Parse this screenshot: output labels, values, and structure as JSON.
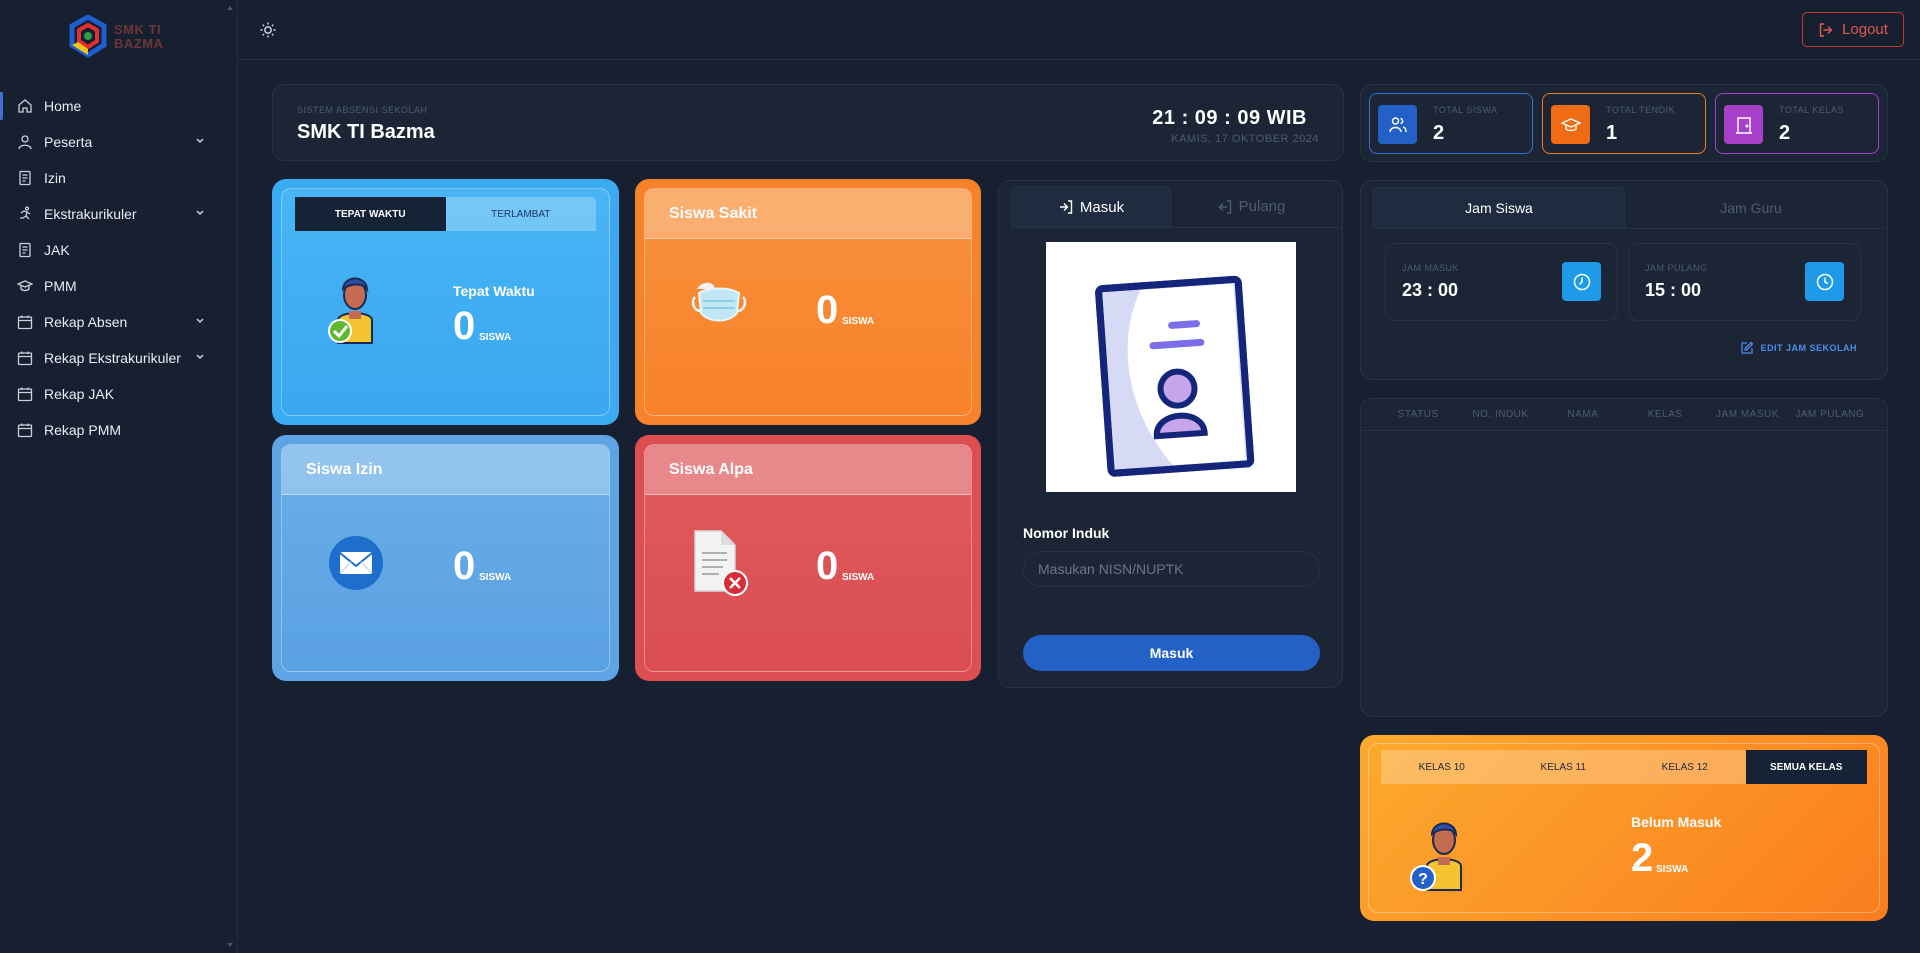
{
  "brand": {
    "line1": "SMK TI",
    "line2": "BAZMA"
  },
  "sidebar": {
    "items": [
      {
        "label": "Home",
        "icon": "home-icon"
      },
      {
        "label": "Peserta",
        "icon": "user-icon"
      },
      {
        "label": "Izin",
        "icon": "document-icon"
      },
      {
        "label": "Ekstrakurikuler",
        "icon": "running-icon"
      },
      {
        "label": "JAK",
        "icon": "document-icon"
      },
      {
        "label": "PMM",
        "icon": "graduation-cap-icon"
      },
      {
        "label": "Rekap Absen",
        "icon": "calendar-icon"
      },
      {
        "label": "Rekap Ekstrakurikuler",
        "icon": "calendar-icon"
      },
      {
        "label": "Rekap JAK",
        "icon": "calendar-icon"
      },
      {
        "label": "Rekap PMM",
        "icon": "calendar-icon"
      }
    ]
  },
  "topbar": {
    "logout_label": "Logout"
  },
  "header": {
    "subtitle": "SISTEM ABSENSI SEKOLAH",
    "school": "SMK TI Bazma",
    "clock": "21 : 09 : 09 WIB",
    "date": "KAMIS, 17 OKTOBER 2024"
  },
  "cards": {
    "tepat": {
      "tab_active": "TEPAT WAKTU",
      "tab_other": "TERLAMBAT",
      "title": "Tepat Waktu",
      "count": "0",
      "unit": "SISWA"
    },
    "sakit": {
      "title": "Siswa Sakit",
      "count": "0",
      "unit": "SISWA"
    },
    "izin": {
      "title": "Siswa Izin",
      "count": "0",
      "unit": "SISWA"
    },
    "alpa": {
      "title": "Siswa Alpa",
      "count": "0",
      "unit": "SISWA"
    }
  },
  "form": {
    "tab_masuk": "Masuk",
    "tab_pulang": "Pulang",
    "label": "Nomor Induk",
    "placeholder": "Masukan NISN/NUPTK",
    "submit": "Masuk"
  },
  "totals": {
    "siswa": {
      "label": "TOTAL SISWA",
      "value": "2"
    },
    "tendik": {
      "label": "TOTAL TENDIK",
      "value": "1"
    },
    "kelas": {
      "label": "TOTAL KELAS",
      "value": "2"
    }
  },
  "jam": {
    "tab_siswa": "Jam Siswa",
    "tab_guru": "Jam Guru",
    "masuk_label": "JAM MASUK",
    "masuk_value": "23 : 00",
    "pulang_label": "JAM PULANG",
    "pulang_value": "15 : 00",
    "edit_label": "EDIT JAM SEKOLAH"
  },
  "table": {
    "columns": [
      "STATUS",
      "NO. INDUK",
      "NAMA",
      "KELAS",
      "JAM MASUK",
      "JAM PULANG"
    ]
  },
  "belum": {
    "tabs": [
      "KELAS 10",
      "KELAS 11",
      "KELAS 12",
      "SEMUA KELAS"
    ],
    "title": "Belum Masuk",
    "count": "2",
    "unit": "SISWA"
  },
  "colors": {
    "blue_card": "#3aaaf1",
    "orange_card": "#f8822a",
    "izin_card": "#5ea4e4",
    "alpa_card": "#dd4e52",
    "accent": "#2361c6",
    "logout": "#e0574f"
  }
}
